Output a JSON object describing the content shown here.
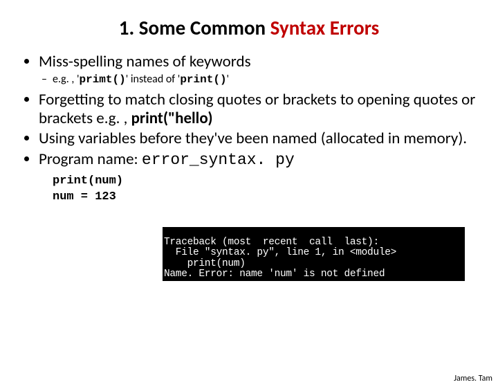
{
  "title": {
    "number": "1.",
    "prefix": "Some Common ",
    "highlight": "Syntax Errors"
  },
  "bullets": {
    "b1": "Miss-spelling names of keywords",
    "b1sub_prefix": "e.g. , '",
    "b1sub_code1": "primt()",
    "b1sub_mid": "' instead of '",
    "b1sub_code2": "print()",
    "b1sub_suffix": "'",
    "b2_a": "Forgetting to match closing quotes or brackets to opening quotes or brackets e.g. , ",
    "b2_b": "print(\"hello)",
    "b3": "Using variables before they've been named (allocated in memory).",
    "b4_a": "Program name: ",
    "b4_b": "error_syntax. py"
  },
  "code": {
    "line1": "print(num)",
    "line2": "num = 123"
  },
  "terminal": {
    "l1": "                                       ",
    "l2": "Traceback (most  recent  call  last):",
    "l3": "  File \"syntax. py\", line 1, in <module>",
    "l4": "    print(num)",
    "l5": "Name. Error: name 'num' is not defined"
  },
  "footer": "James. Tam"
}
